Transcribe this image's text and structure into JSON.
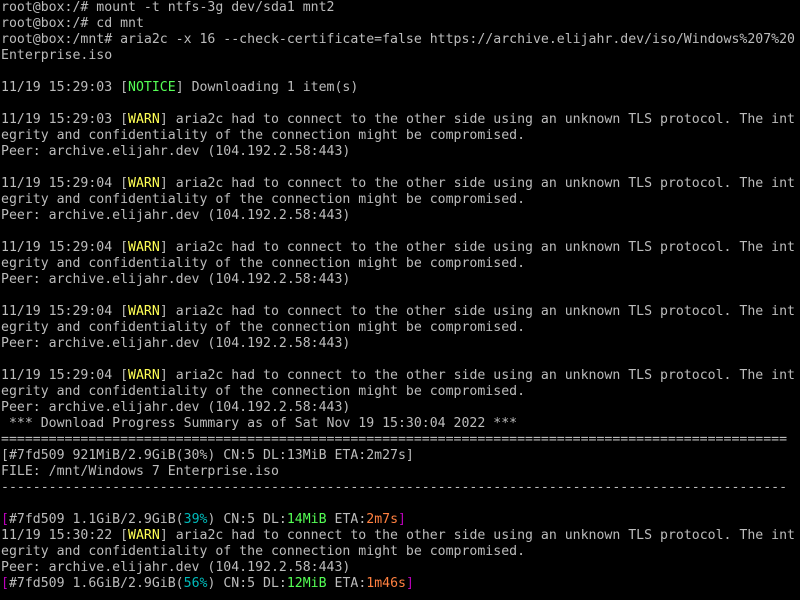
{
  "colors": {
    "background": "#000000",
    "text": "#bcbcbc",
    "notice": "#55ff55",
    "warn": "#ffff55",
    "gid_bracket": "#bb00bb",
    "percent": "#00bbbb",
    "speed": "#55ff55",
    "eta": "#ff8040"
  },
  "terminal": {
    "lines": [
      {
        "segments": [
          {
            "text": "root@box:/# mount -t ntfs-3g dev/sda1 mnt2"
          }
        ]
      },
      {
        "segments": [
          {
            "text": "root@box:/# cd mnt"
          }
        ]
      },
      {
        "segments": [
          {
            "text": "root@box:/mnt# aria2c -x 16 --check-certificate=false https://archive.elijahr.dev/iso/Windows%207%20"
          }
        ]
      },
      {
        "segments": [
          {
            "text": "Enterprise.iso"
          }
        ]
      },
      {
        "segments": [
          {
            "text": ""
          }
        ]
      },
      {
        "segments": [
          {
            "text": "11/19 15:29:03 ["
          },
          {
            "text": "NOTICE",
            "class": "notice"
          },
          {
            "text": "] Downloading 1 item(s)"
          }
        ]
      },
      {
        "segments": [
          {
            "text": ""
          }
        ]
      },
      {
        "segments": [
          {
            "text": "11/19 15:29:03 ["
          },
          {
            "text": "WARN",
            "class": "warn"
          },
          {
            "text": "] aria2c had to connect to the other side using an unknown TLS protocol. The int"
          }
        ]
      },
      {
        "segments": [
          {
            "text": "egrity and confidentiality of the connection might be compromised."
          }
        ]
      },
      {
        "segments": [
          {
            "text": "Peer: archive.elijahr.dev (104.192.2.58:443)"
          }
        ]
      },
      {
        "segments": [
          {
            "text": ""
          }
        ]
      },
      {
        "segments": [
          {
            "text": "11/19 15:29:04 ["
          },
          {
            "text": "WARN",
            "class": "warn"
          },
          {
            "text": "] aria2c had to connect to the other side using an unknown TLS protocol. The int"
          }
        ]
      },
      {
        "segments": [
          {
            "text": "egrity and confidentiality of the connection might be compromised."
          }
        ]
      },
      {
        "segments": [
          {
            "text": "Peer: archive.elijahr.dev (104.192.2.58:443)"
          }
        ]
      },
      {
        "segments": [
          {
            "text": ""
          }
        ]
      },
      {
        "segments": [
          {
            "text": "11/19 15:29:04 ["
          },
          {
            "text": "WARN",
            "class": "warn"
          },
          {
            "text": "] aria2c had to connect to the other side using an unknown TLS protocol. The int"
          }
        ]
      },
      {
        "segments": [
          {
            "text": "egrity and confidentiality of the connection might be compromised."
          }
        ]
      },
      {
        "segments": [
          {
            "text": "Peer: archive.elijahr.dev (104.192.2.58:443)"
          }
        ]
      },
      {
        "segments": [
          {
            "text": ""
          }
        ]
      },
      {
        "segments": [
          {
            "text": "11/19 15:29:04 ["
          },
          {
            "text": "WARN",
            "class": "warn"
          },
          {
            "text": "] aria2c had to connect to the other side using an unknown TLS protocol. The int"
          }
        ]
      },
      {
        "segments": [
          {
            "text": "egrity and confidentiality of the connection might be compromised."
          }
        ]
      },
      {
        "segments": [
          {
            "text": "Peer: archive.elijahr.dev (104.192.2.58:443)"
          }
        ]
      },
      {
        "segments": [
          {
            "text": ""
          }
        ]
      },
      {
        "segments": [
          {
            "text": "11/19 15:29:04 ["
          },
          {
            "text": "WARN",
            "class": "warn"
          },
          {
            "text": "] aria2c had to connect to the other side using an unknown TLS protocol. The int"
          }
        ]
      },
      {
        "segments": [
          {
            "text": "egrity and confidentiality of the connection might be compromised."
          }
        ]
      },
      {
        "segments": [
          {
            "text": "Peer: archive.elijahr.dev (104.192.2.58:443)"
          }
        ]
      },
      {
        "segments": [
          {
            "text": " *** Download Progress Summary as of Sat Nov 19 15:30:04 2022 ***"
          }
        ]
      },
      {
        "segments": [
          {
            "text": "==================================================================================================="
          }
        ]
      },
      {
        "segments": [
          {
            "text": "[#7fd509 921MiB/2.9GiB(30%) CN:5 DL:13MiB ETA:2m27s]"
          }
        ]
      },
      {
        "segments": [
          {
            "text": "FILE: /mnt/Windows 7 Enterprise.iso"
          }
        ]
      },
      {
        "segments": [
          {
            "text": "---------------------------------------------------------------------------------------------------"
          }
        ]
      },
      {
        "segments": [
          {
            "text": ""
          }
        ]
      },
      {
        "segments": [
          {
            "text": "[",
            "class": "magenta"
          },
          {
            "text": "#7fd509 1.1GiB/2.9GiB("
          },
          {
            "text": "39%",
            "class": "cyan"
          },
          {
            "text": ") CN:5 DL:"
          },
          {
            "text": "14MiB",
            "class": "green"
          },
          {
            "text": " ETA:"
          },
          {
            "text": "2m7s",
            "class": "orange"
          },
          {
            "text": "]",
            "class": "magenta"
          }
        ]
      },
      {
        "segments": [
          {
            "text": "11/19 15:30:22 ["
          },
          {
            "text": "WARN",
            "class": "warn"
          },
          {
            "text": "] aria2c had to connect to the other side using an unknown TLS protocol. The int"
          }
        ]
      },
      {
        "segments": [
          {
            "text": "egrity and confidentiality of the connection might be compromised."
          }
        ]
      },
      {
        "segments": [
          {
            "text": "Peer: archive.elijahr.dev (104.192.2.58:443)"
          }
        ]
      },
      {
        "segments": [
          {
            "text": "[",
            "class": "magenta"
          },
          {
            "text": "#7fd509 1.6GiB/2.9GiB("
          },
          {
            "text": "56%",
            "class": "cyan"
          },
          {
            "text": ") CN:5 DL:"
          },
          {
            "text": "12MiB",
            "class": "green"
          },
          {
            "text": " ETA:"
          },
          {
            "text": "1m46s",
            "class": "orange"
          },
          {
            "text": "]",
            "class": "magenta"
          }
        ]
      }
    ]
  }
}
